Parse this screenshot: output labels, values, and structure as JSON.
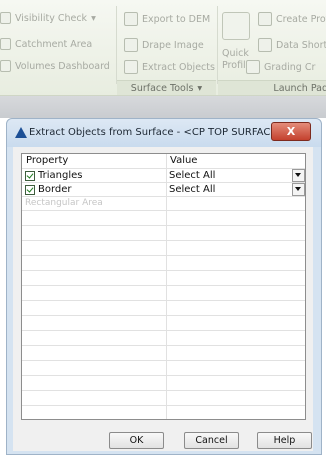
{
  "ribbon": {
    "col1": [
      "Visibility Check",
      "Catchment Area",
      "Volumes Dashboard"
    ],
    "col2": [
      "Export to DEM",
      "Drape Image",
      "Extract Objects"
    ],
    "panel_label": "Surface Tools",
    "panel_arrow": "▾",
    "quick_profile_lines": [
      "Quick",
      "Profile"
    ],
    "col4": [
      "Create Prof",
      "Data Shorte",
      "Grading Cr"
    ],
    "launch_pad": "Launch Pad",
    "visibility_arrow": "▾"
  },
  "dialog": {
    "title": "Extract Objects from Surface - <CP TOP SURFACE>",
    "close": "X",
    "headers": {
      "property": "Property",
      "value": "Value"
    },
    "rows": [
      {
        "label": "Triangles",
        "checked": true,
        "value": "Select All"
      },
      {
        "label": "Border",
        "checked": true,
        "value": "Select All"
      }
    ],
    "faint_text": "Rectangular Area",
    "buttons": {
      "ok": "OK",
      "cancel": "Cancel",
      "help": "Help"
    }
  }
}
